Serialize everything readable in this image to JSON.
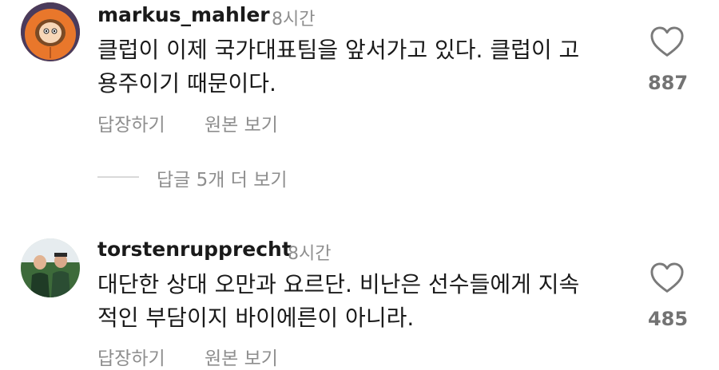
{
  "comments": [
    {
      "username": "markus_mahler",
      "time": "8시간",
      "lines": [
        "클럽이 이제 국가대표팀을 앞서가고 있다. 클럽이 고",
        "용주이기 때문이다."
      ],
      "likes": "887",
      "reply_label": "답장하기",
      "translate_label": "원본 보기"
    },
    {
      "username": "torstenrupprecht",
      "time": "8시간",
      "lines": [
        "대단한 상대 오만과 요르단. 비난은 선수들에게 지속",
        "적인 부담이지 바이에른이 아니라."
      ],
      "likes": "485",
      "reply_label": "답장하기",
      "translate_label": "원본 보기"
    }
  ],
  "view_replies": "답글 5개 더 보기",
  "icons": {
    "like": "heart-outline-icon"
  },
  "colors": {
    "secondary_text": "#8e8e8e",
    "primary_text": "#1a1a1a"
  }
}
